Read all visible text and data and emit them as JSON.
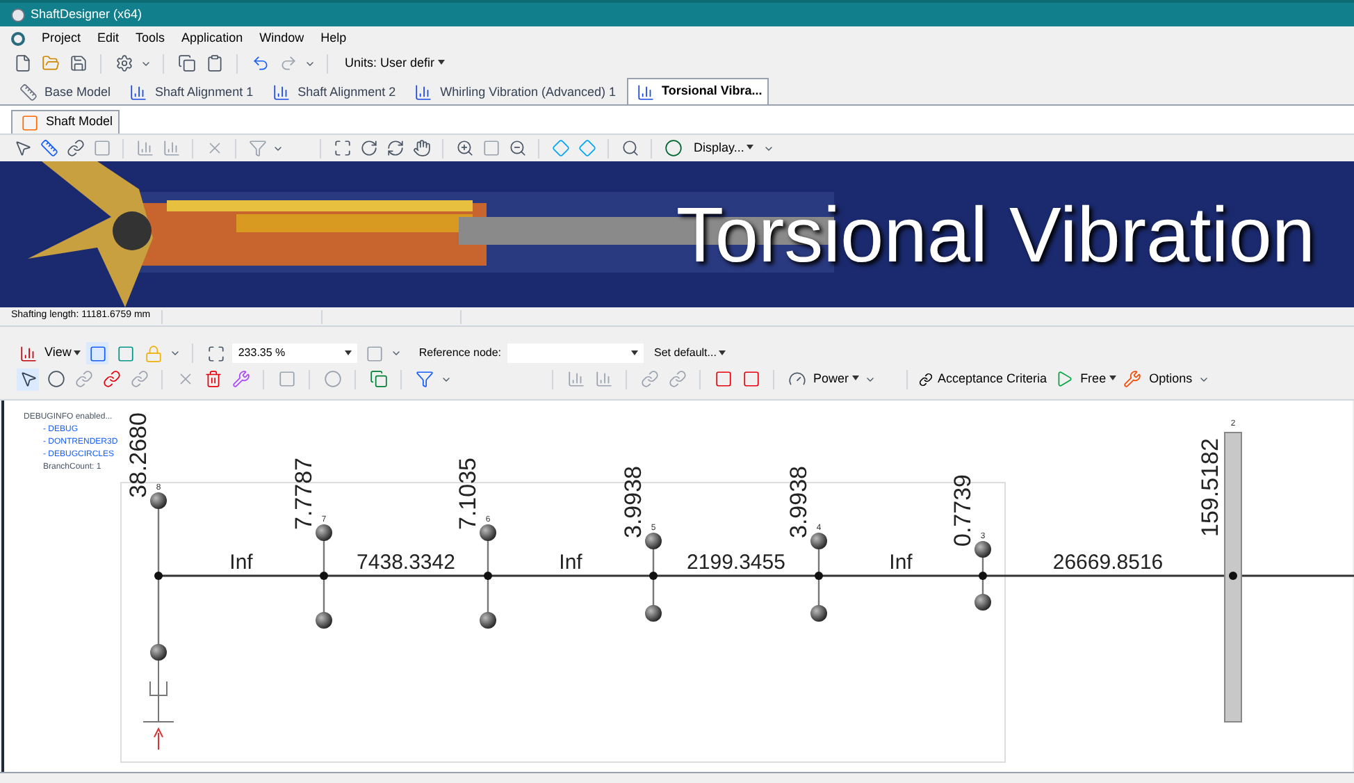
{
  "window": {
    "title": "ShaftDesigner (x64)"
  },
  "menu": [
    "Project",
    "Edit",
    "Tools",
    "Application",
    "Window",
    "Help"
  ],
  "toolbar": {
    "units": "Units: User defir"
  },
  "document_tabs": [
    {
      "label": "Base Model",
      "selected": false
    },
    {
      "label": "Shaft Alignment 1",
      "selected": false
    },
    {
      "label": "Shaft Alignment 2",
      "selected": false
    },
    {
      "label": "Whirling Vibration (Advanced) 1",
      "selected": false
    },
    {
      "label": "Torsional Vibra...",
      "selected": true
    }
  ],
  "sub_tabs": [
    {
      "label": "Shaft Model",
      "selected": true
    }
  ],
  "model_toolbar": {
    "display": "Display..."
  },
  "banner": {
    "title": "Torsional Vibration"
  },
  "status_bar": [
    "Shafting length: 11181.6759 mm"
  ],
  "view_toolbar": {
    "view": "View",
    "zoom": "233.35 %",
    "reference_label": "Reference node:",
    "set_default": "Set default..."
  },
  "tools_toolbar": {
    "power": "Power",
    "acceptance": "Acceptance Criteria",
    "free": "Free",
    "options": "Options"
  },
  "debug": {
    "header": "DEBUGINFO enabled...",
    "flags": [
      "- DEBUG",
      "- DONTRENDER3D",
      "- DEBUGCIRCLES"
    ],
    "branch_count": "BranchCount: 1"
  },
  "diagram": {
    "nodes": [
      {
        "id": "8",
        "inertia": "38.2680",
        "kind": "mass"
      },
      {
        "id": "7",
        "inertia": "7.7787",
        "kind": "mass"
      },
      {
        "id": "6",
        "inertia": "7.1035",
        "kind": "mass"
      },
      {
        "id": "5",
        "inertia": "3.9938",
        "kind": "mass"
      },
      {
        "id": "4",
        "inertia": "3.9938",
        "kind": "mass"
      },
      {
        "id": "3",
        "inertia": "0.7739",
        "kind": "mass"
      },
      {
        "id": "2",
        "inertia": "159.5182",
        "kind": "bar"
      }
    ],
    "springs": [
      "Inf",
      "7438.3342",
      "Inf",
      "2199.3455",
      "Inf",
      "26669.8516"
    ]
  }
}
